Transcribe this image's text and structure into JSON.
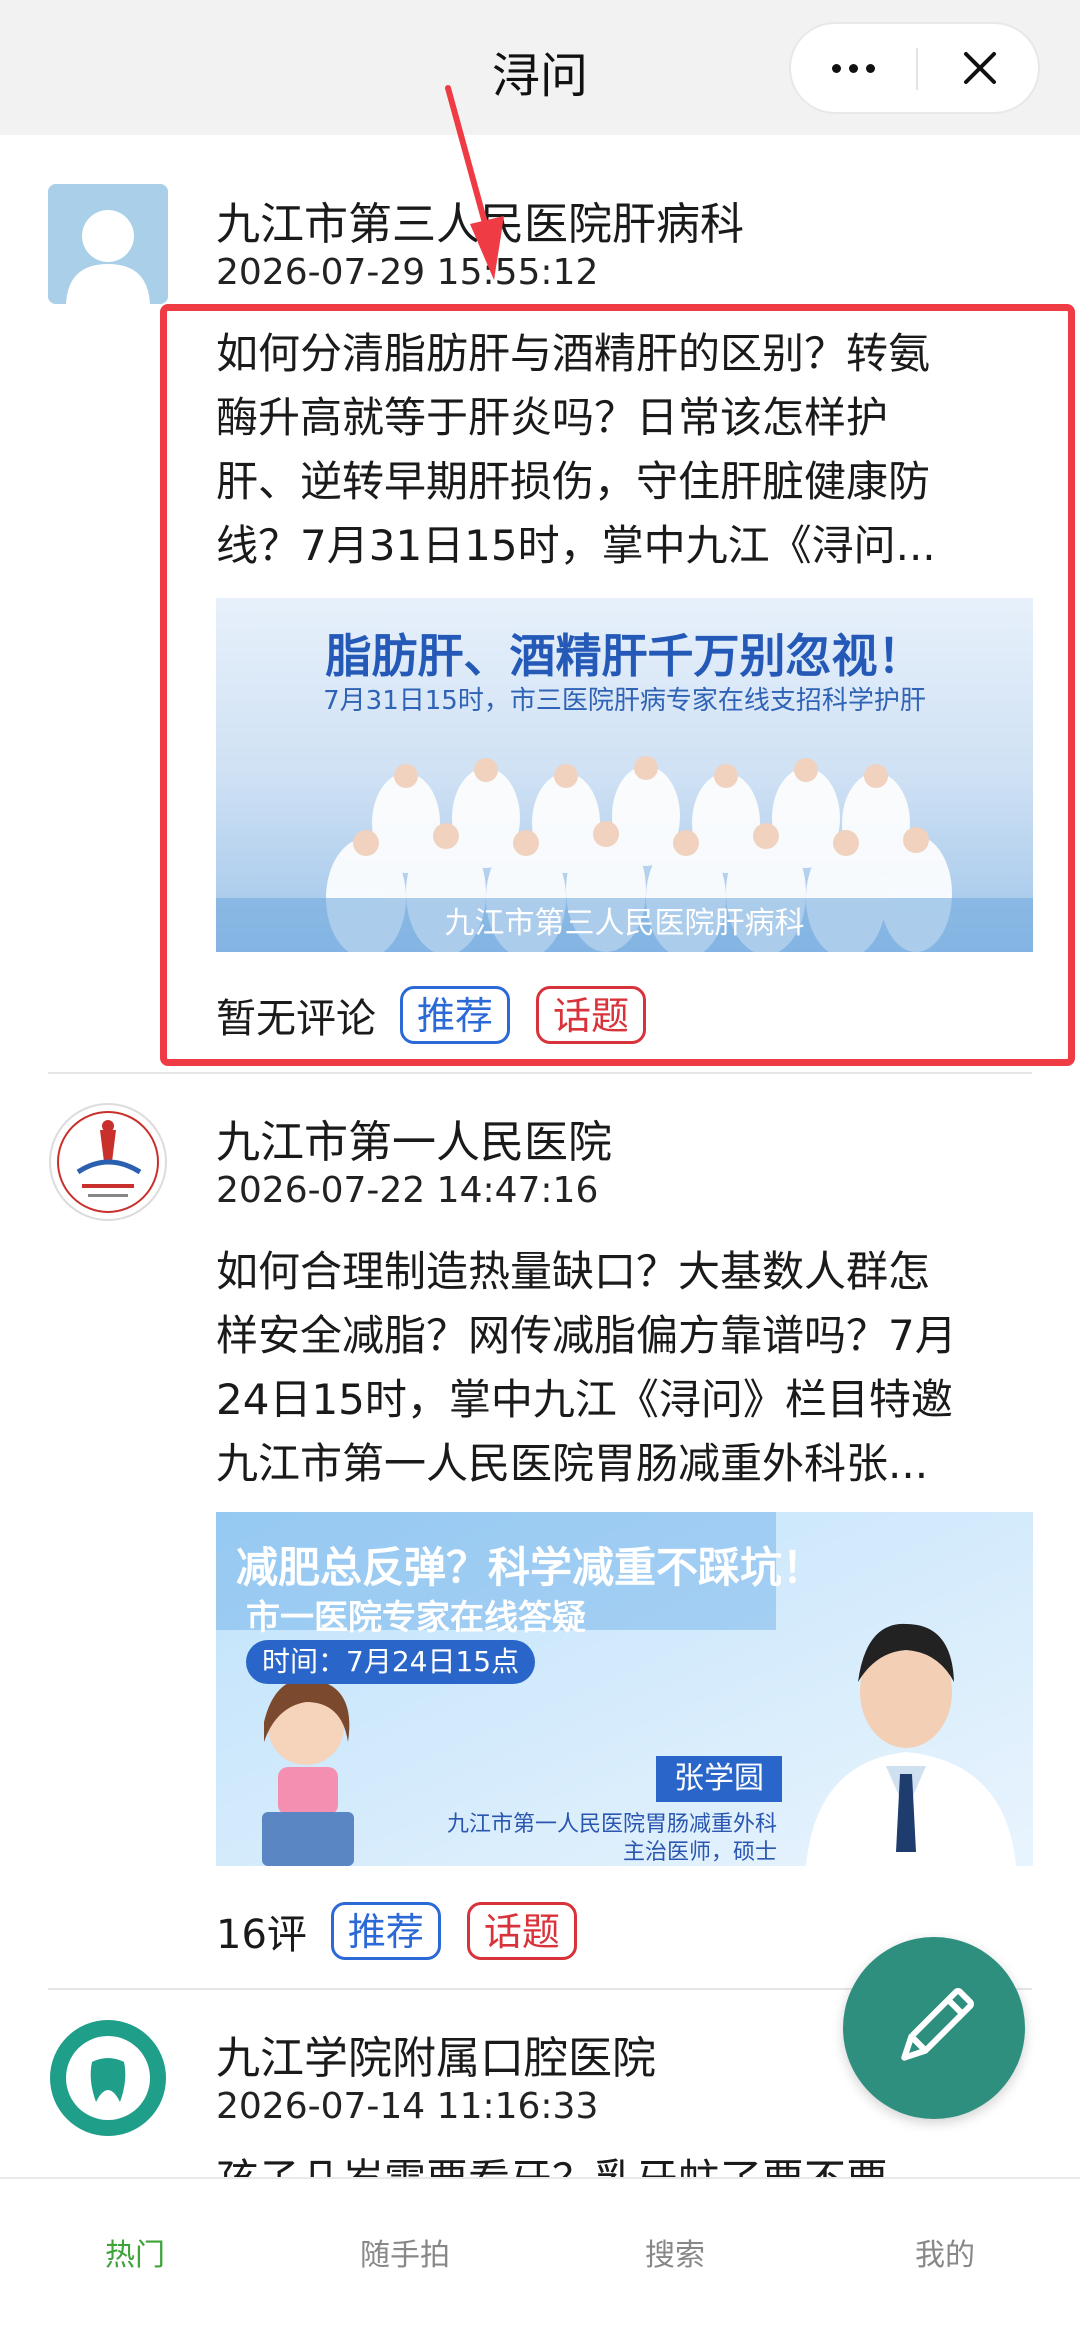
{
  "header": {
    "title": "浔问"
  },
  "posts": [
    {
      "author": "九江市第三人民医院肝病科",
      "time": "2026-07-29 15:55:12",
      "content_lines": [
        "如何分清脂肪肝与酒精肝的区别？转氨",
        "酶升高就等于肝炎吗？日常该怎样护",
        "肝、逆转早期肝损伤，守住肝脏健康防",
        "线？7月31日15时，掌中九江《浔问..."
      ],
      "banner": {
        "title": "脂肪肝、酒精肝千万别忽视！",
        "subtitle": "7月31日15时，市三医院肝病专家在线支招科学护肝",
        "footer": "九江市第三人民医院肝病科"
      },
      "comment_count": "暂无评论",
      "tags": [
        "推荐",
        "话题"
      ]
    },
    {
      "author": "九江市第一人民医院",
      "time": "2026-07-22 14:47:16",
      "content_lines": [
        "如何合理制造热量缺口？大基数人群怎",
        "样安全减脂？网传减脂偏方靠谱吗？7月",
        "24日15时，掌中九江《浔问》栏目特邀",
        "九江市第一人民医院胃肠减重外科张..."
      ],
      "banner": {
        "title": "减肥总反弹？科学减重不踩坑！",
        "subtitle": "市一医院专家在线答疑",
        "time": "时间：7月24日15点",
        "doctor_name": "张学圆",
        "doctor_dept": "九江市第一人民医院胃肠减重外科",
        "doctor_role": "主治医师，硕士"
      },
      "comment_count": "16评",
      "tags": [
        "推荐",
        "话题"
      ]
    },
    {
      "author": "九江学院附属口腔医院",
      "time": "2026-07-14 11:16:33",
      "content_preview": "孩子几岁需要看牙？乳牙蛀了要不要"
    }
  ],
  "tabbar": {
    "items": [
      "热门",
      "随手拍",
      "搜索",
      "我的"
    ],
    "active_index": 0
  },
  "colors": {
    "accent_green": "#3fa33a",
    "fab": "#2f8f7e",
    "tag_blue": "#2b69d6",
    "tag_red": "#d8323a",
    "highlight": "#ef3b44"
  },
  "icons": {
    "more": "more-dots-icon",
    "close": "close-icon",
    "fab": "pencil-icon"
  }
}
